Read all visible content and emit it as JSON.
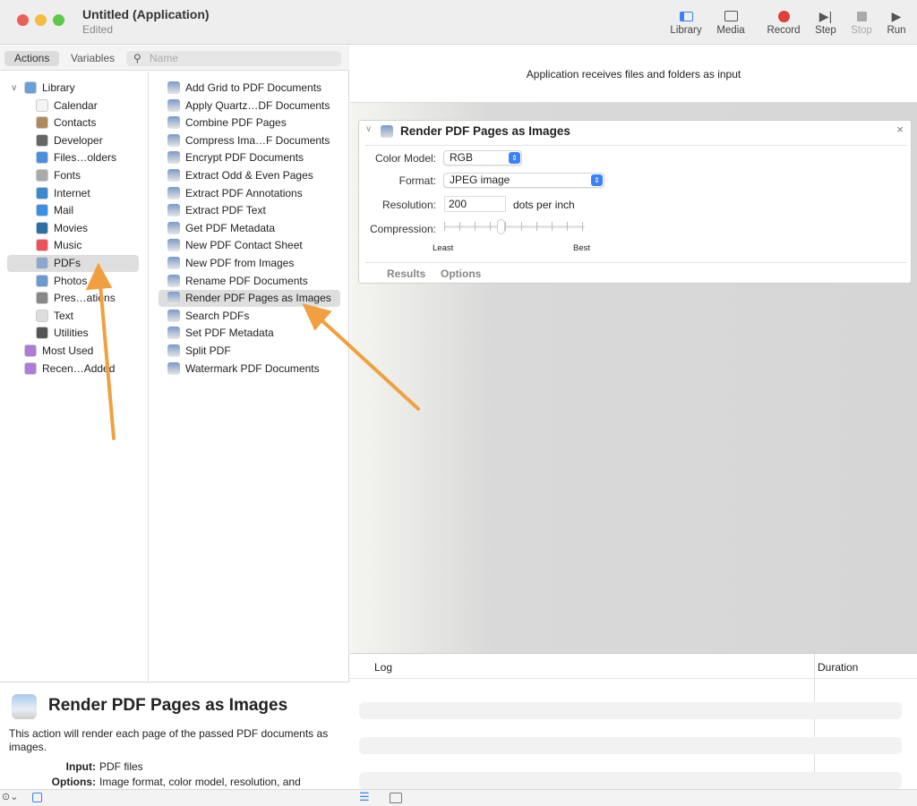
{
  "window": {
    "title": "Untitled (Application)",
    "subtitle": "Edited"
  },
  "toolbar": [
    {
      "label": "Library",
      "icon": "sidebar-icon"
    },
    {
      "label": "Media",
      "icon": "media-icon"
    },
    {
      "label": "Record",
      "icon": "record-icon"
    },
    {
      "label": "Step",
      "icon": "step-icon"
    },
    {
      "label": "Stop",
      "icon": "stop-icon"
    },
    {
      "label": "Run",
      "icon": "play-icon"
    }
  ],
  "colors": {
    "record": "#e0403a",
    "accent": "#3b82f6",
    "arrow": "#f0a040"
  },
  "tabs": {
    "actions": "Actions",
    "variables": "Variables"
  },
  "search": {
    "placeholder": "Name"
  },
  "library": [
    {
      "label": "Library",
      "color": "#6aa0d8"
    },
    {
      "label": "Calendar",
      "color": "#f4f4f4"
    },
    {
      "label": "Contacts",
      "color": "#b08a5a"
    },
    {
      "label": "Developer",
      "color": "#666"
    },
    {
      "label": "Files…olders",
      "color": "#4a8ee0"
    },
    {
      "label": "Fonts",
      "color": "#aaa"
    },
    {
      "label": "Internet",
      "color": "#3a8ad0"
    },
    {
      "label": "Mail",
      "color": "#3a90e8"
    },
    {
      "label": "Movies",
      "color": "#2c6ea8"
    },
    {
      "label": "Music",
      "color": "#f0505a"
    },
    {
      "label": "PDFs",
      "color": "#8aa8d0"
    },
    {
      "label": "Photos",
      "color": "#6a9ad0"
    },
    {
      "label": "Pres…ations",
      "color": "#888"
    },
    {
      "label": "Text",
      "color": "#ddd"
    },
    {
      "label": "Utilities",
      "color": "#555"
    },
    {
      "label": "Most Used",
      "color": "#b07ad8"
    },
    {
      "label": "Recen…Added",
      "color": "#b07ad8"
    }
  ],
  "library_selected": "PDFs",
  "actions": [
    "Add Grid to PDF Documents",
    "Apply Quartz…DF Documents",
    "Combine PDF Pages",
    "Compress Ima…F Documents",
    "Encrypt PDF Documents",
    "Extract Odd & Even Pages",
    "Extract PDF Annotations",
    "Extract PDF Text",
    "Get PDF Metadata",
    "New PDF Contact Sheet",
    "New PDF from Images",
    "Rename PDF Documents",
    "Render PDF Pages as Images",
    "Search PDFs",
    "Set PDF Metadata",
    "Split PDF",
    "Watermark PDF Documents"
  ],
  "actions_selected": "Render PDF Pages as Images",
  "description": {
    "title": "Render PDF Pages as Images",
    "body": "This action will render each page of the passed PDF documents as images.",
    "input_label": "Input:",
    "input_value": "PDF files",
    "options_label": "Options:",
    "options_value": "Image format, color model, resolution, and"
  },
  "workflow": {
    "header": "Application receives files and folders as input"
  },
  "card": {
    "title": "Render PDF Pages as Images",
    "color_model_label": "Color Model:",
    "color_model": "RGB",
    "format_label": "Format:",
    "format": "JPEG image",
    "resolution_label": "Resolution:",
    "resolution": "200",
    "resolution_unit": "dots per inch",
    "compression_label": "Compression:",
    "compression_min": "Least",
    "compression_max": "Best",
    "compression_level": 0.4,
    "results_tab": "Results",
    "options_tab": "Options"
  },
  "log": {
    "col_log": "Log",
    "col_duration": "Duration"
  }
}
